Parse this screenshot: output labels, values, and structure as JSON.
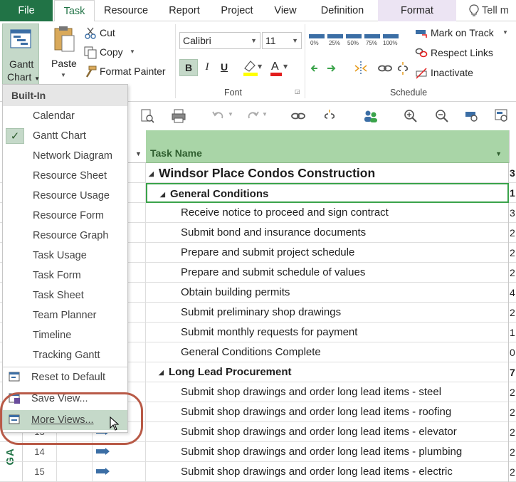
{
  "tabs": {
    "file": "File",
    "task": "Task",
    "resource": "Resource",
    "report": "Report",
    "project": "Project",
    "view": "View",
    "definition": "Definition",
    "format": "Format",
    "tell": "Tell m"
  },
  "ribbon": {
    "gantt_line1": "Gantt",
    "gantt_line2": "Chart",
    "paste": "Paste",
    "cut": "Cut",
    "copy": "Copy",
    "format_painter": "Format Painter",
    "font_name": "Calibri",
    "font_size": "11",
    "bold": "B",
    "italic": "I",
    "underline": "U",
    "font_group": "Font",
    "schedule_group": "Schedule",
    "pct": [
      "0%",
      "25%",
      "50%",
      "75%",
      "100%"
    ],
    "mark_on_track": "Mark on Track",
    "respect_links": "Respect Links",
    "inactivate": "Inactivate"
  },
  "table": {
    "header_name": "Task Name",
    "rows": [
      {
        "name": "Windsor Place Condos Construction",
        "dur": "3"
      },
      {
        "name": "General Conditions",
        "dur": "1"
      },
      {
        "name": "Receive notice to proceed and sign contract",
        "dur": "3"
      },
      {
        "name": "Submit bond and insurance documents",
        "dur": "2"
      },
      {
        "name": "Prepare and submit project schedule",
        "dur": "2"
      },
      {
        "name": "Prepare and submit schedule of values",
        "dur": "2"
      },
      {
        "name": "Obtain building permits",
        "dur": "4"
      },
      {
        "name": "Submit preliminary shop drawings",
        "dur": "2"
      },
      {
        "name": "Submit monthly requests for payment",
        "dur": "1"
      },
      {
        "name": "General Conditions Complete",
        "dur": "0"
      },
      {
        "name": "Long Lead Procurement",
        "dur": "7"
      },
      {
        "name": "Submit shop drawings and order long lead items - steel",
        "dur": "2"
      },
      {
        "name": "Submit shop drawings and order long lead items - roofing",
        "dur": "2"
      },
      {
        "name": "Submit shop drawings and order long lead items - elevator",
        "dur": "2"
      },
      {
        "name": "Submit shop drawings and order long lead items - plumbing",
        "dur": "2"
      },
      {
        "name": "Submit shop drawings and order long lead items - electric",
        "dur": "2"
      }
    ],
    "ids": {
      "r13": "13",
      "r14": "14",
      "r15": "15"
    }
  },
  "side_label": "GA",
  "menu": {
    "header": "Built-In",
    "items": [
      "Calendar",
      "Gantt Chart",
      "Network Diagram",
      "Resource Sheet",
      "Resource Usage",
      "Resource Form",
      "Resource Graph",
      "Task Usage",
      "Task Form",
      "Task Sheet",
      "Team Planner",
      "Timeline",
      "Tracking Gantt"
    ],
    "reset": "Reset to Default",
    "save": "Save View...",
    "more": "More Views..."
  },
  "colors": {
    "accent": "#217346",
    "header_green": "#a9d5a7",
    "highlight_ring": "#b85a47"
  }
}
